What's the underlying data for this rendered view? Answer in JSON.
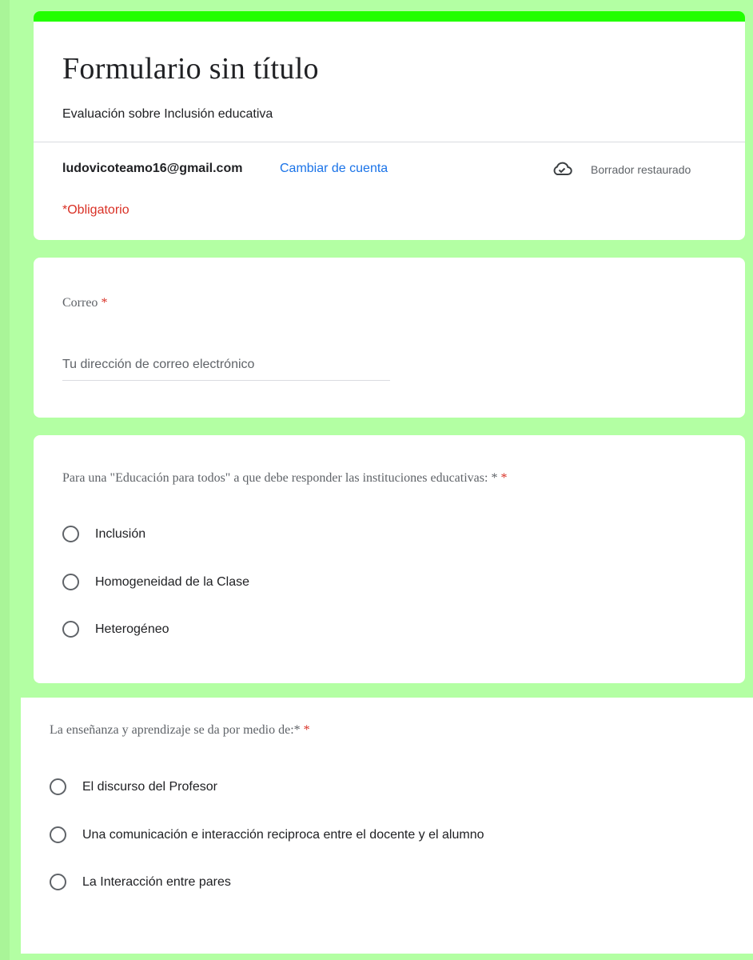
{
  "header": {
    "title": "Formulario sin título",
    "description": "Evaluación sobre Inclusión educativa",
    "account_email": "ludovicoteamo16@gmail.com",
    "switch_account_label": "Cambiar de cuenta",
    "draft_status": "Borrador restaurado",
    "draft_icon": "cloud-check-icon",
    "required_note": "*Obligatorio"
  },
  "email_question": {
    "label": "Correo",
    "asterisk": "*",
    "placeholder": "Tu dirección de correo electrónico",
    "value": ""
  },
  "questions": [
    {
      "label": "Para una \"Educación para todos\" a que debe responder las instituciones educativas: *",
      "asterisk": "*",
      "options": [
        "Inclusión",
        "Homogeneidad de la Clase",
        "Heterogéneo"
      ]
    },
    {
      "label": "La enseñanza y aprendizaje se da por medio de:*",
      "asterisk": "*",
      "options": [
        "El discurso del Profesor",
        "Una comunicación e interacción reciproca entre el docente y el alumno",
        "La Interacción entre pares"
      ]
    }
  ],
  "colors": {
    "background": "#b3ffa3",
    "accent": "#22ff00",
    "link": "#1a73e8",
    "required": "#d93025"
  }
}
